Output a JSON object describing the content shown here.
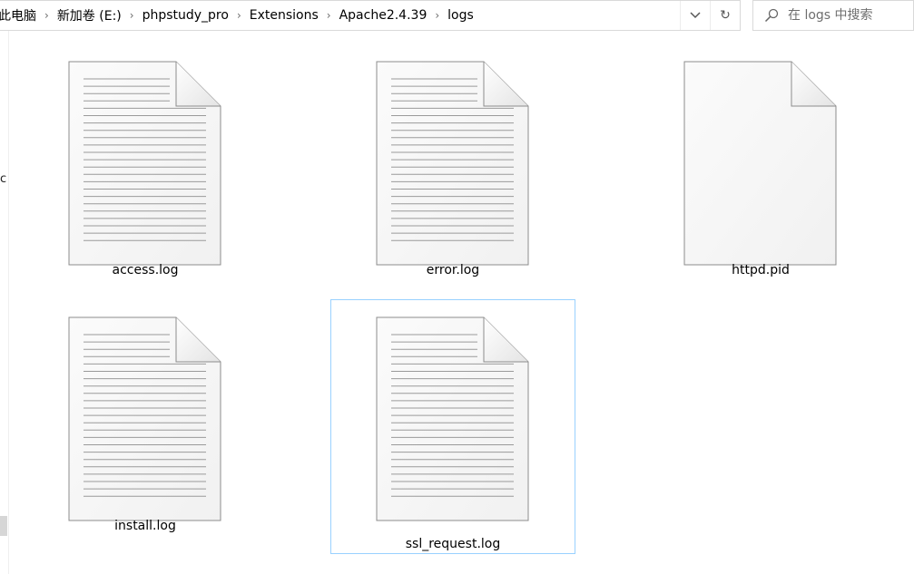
{
  "address_bar": {
    "breadcrumbs": [
      "此电脑",
      "新加卷 (E:)",
      "phpstudy_pro",
      "Extensions",
      "Apache2.4.39",
      "logs"
    ],
    "separator_icon": "chevron-right-icon",
    "dropdown_icon": "chevron-down-icon",
    "refresh_icon": "refresh-icon"
  },
  "search": {
    "placeholder": "在 logs 中搜索",
    "icon": "search-icon"
  },
  "left_pane": {
    "fragment_text": "c"
  },
  "files": [
    {
      "name": "access.log",
      "icon": "text-document-icon",
      "selected": false
    },
    {
      "name": "error.log",
      "icon": "text-document-icon",
      "selected": false
    },
    {
      "name": "httpd.pid",
      "icon": "blank-document-icon",
      "selected": false
    },
    {
      "name": "install.log",
      "icon": "text-document-icon",
      "selected": false
    },
    {
      "name": "ssl_request.log",
      "icon": "text-document-icon",
      "selected": true
    }
  ],
  "colors": {
    "selection_border": "#99d1ff",
    "document_line": "#9a9a9a",
    "document_border": "#8c8c8c"
  }
}
